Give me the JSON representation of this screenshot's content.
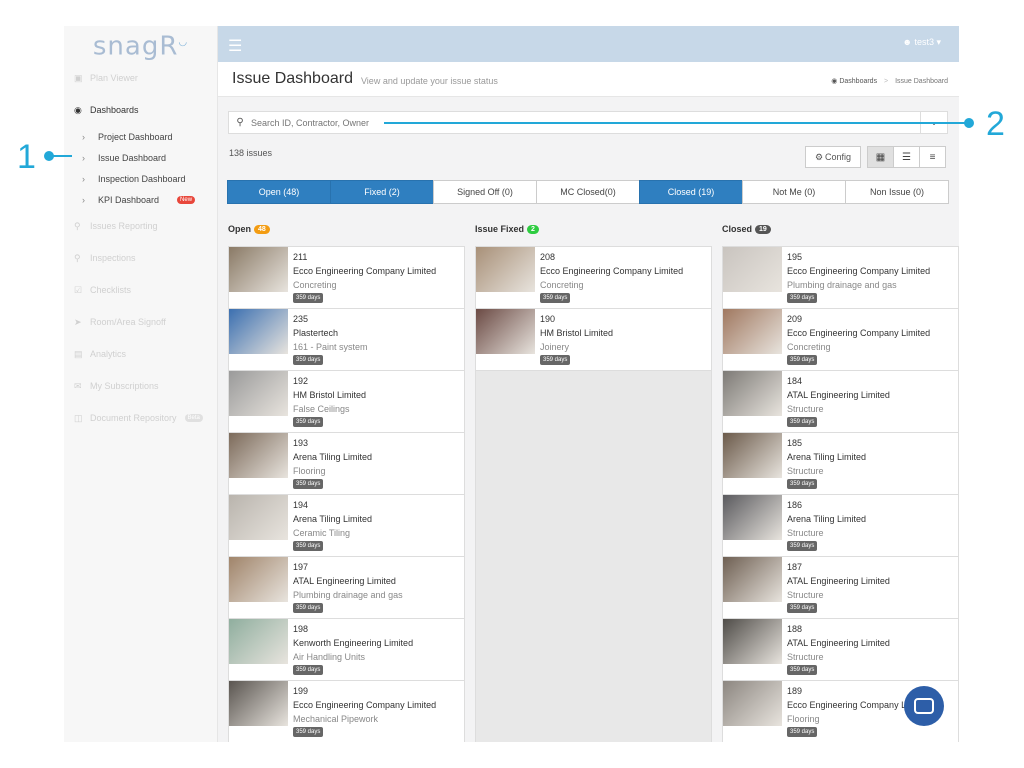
{
  "app": {
    "logo": "snagR",
    "user": "test3"
  },
  "colors": {
    "topbar": "#c7d8e8",
    "active_filter": "#2f7fc0",
    "open_badge": "#f39c12",
    "fixed_badge": "#2ecc40",
    "closed_badge": "#555555",
    "callout": "#22a8d8"
  },
  "sidebar": {
    "items": [
      {
        "label": "Plan Viewer",
        "icon": "image-icon"
      },
      {
        "label": "Dashboards",
        "icon": "dashboard-icon"
      },
      {
        "label": "Issues Reporting",
        "icon": "map-pin-icon"
      },
      {
        "label": "Inspections",
        "icon": "search-icon"
      },
      {
        "label": "Checklists",
        "icon": "checkbox-icon"
      },
      {
        "label": "Room/Area Signoff",
        "icon": "send-icon"
      },
      {
        "label": "Analytics",
        "icon": "bar-chart-icon"
      },
      {
        "label": "My Subscriptions",
        "icon": "envelope-icon"
      },
      {
        "label": "Document Repository",
        "icon": "clipboard-icon",
        "badge": "Beta"
      }
    ],
    "sub_items": [
      {
        "label": "Project Dashboard"
      },
      {
        "label": "Issue Dashboard"
      },
      {
        "label": "Inspection Dashboard"
      },
      {
        "label": "KPI Dashboard",
        "badge": "New"
      }
    ]
  },
  "header": {
    "title": "Issue Dashboard",
    "subtitle": "View and update your issue status",
    "breadcrumb": [
      "Dashboards",
      "Issue Dashboard"
    ]
  },
  "search": {
    "placeholder": "Search ID, Contractor, Owner"
  },
  "issue_count": "138 issues",
  "config_label": "Config",
  "filters": [
    {
      "label": "Open (48)",
      "active": true
    },
    {
      "label": "Fixed (2)",
      "active": true
    },
    {
      "label": "Signed Off (0)",
      "active": false
    },
    {
      "label": "MC Closed(0)",
      "active": false
    },
    {
      "label": "Closed (19)",
      "active": true
    },
    {
      "label": "Not Me (0)",
      "active": false
    },
    {
      "label": "Non Issue (0)",
      "active": false
    }
  ],
  "columns": [
    {
      "title": "Open",
      "count": "48",
      "cards": [
        {
          "id": "211",
          "company": "Ecco Engineering Company Limited",
          "trade": "Concreting",
          "age": "359 days"
        },
        {
          "id": "235",
          "company": "Plastertech",
          "trade": "161 - Paint system",
          "age": "359 days"
        },
        {
          "id": "192",
          "company": "HM Bristol Limited",
          "trade": "False Ceilings",
          "age": "359 days"
        },
        {
          "id": "193",
          "company": "Arena Tiling Limited",
          "trade": "Flooring",
          "age": "359 days"
        },
        {
          "id": "194",
          "company": "Arena Tiling Limited",
          "trade": "Ceramic Tiling",
          "age": "359 days"
        },
        {
          "id": "197",
          "company": "ATAL Engineering Limited",
          "trade": "Plumbing drainage and gas",
          "age": "359 days"
        },
        {
          "id": "198",
          "company": "Kenworth Engineering Limited",
          "trade": "Air Handling Units",
          "age": "359 days"
        },
        {
          "id": "199",
          "company": "Ecco Engineering Company Limited",
          "trade": "Mechanical Pipework",
          "age": "359 days"
        }
      ]
    },
    {
      "title": "Issue Fixed",
      "count": "2",
      "cards": [
        {
          "id": "208",
          "company": "Ecco Engineering Company Limited",
          "trade": "Concreting",
          "age": "359 days"
        },
        {
          "id": "190",
          "company": "HM Bristol Limited",
          "trade": "Joinery",
          "age": "359 days"
        }
      ]
    },
    {
      "title": "Closed",
      "count": "19",
      "cards": [
        {
          "id": "195",
          "company": "Ecco Engineering Company Limited",
          "trade": "Plumbing drainage and gas",
          "age": "359 days"
        },
        {
          "id": "209",
          "company": "Ecco Engineering Company Limited",
          "trade": "Concreting",
          "age": "359 days"
        },
        {
          "id": "184",
          "company": "ATAL Engineering Limited",
          "trade": "Structure",
          "age": "359 days"
        },
        {
          "id": "185",
          "company": "Arena Tiling Limited",
          "trade": "Structure",
          "age": "359 days"
        },
        {
          "id": "186",
          "company": "Arena Tiling Limited",
          "trade": "Structure",
          "age": "359 days"
        },
        {
          "id": "187",
          "company": "ATAL Engineering Limited",
          "trade": "Structure",
          "age": "359 days"
        },
        {
          "id": "188",
          "company": "ATAL Engineering Limited",
          "trade": "Structure",
          "age": "359 days"
        },
        {
          "id": "189",
          "company": "Ecco Engineering Company Limited",
          "trade": "Flooring",
          "age": "359 days"
        }
      ]
    }
  ],
  "callouts": [
    "1",
    "2"
  ]
}
